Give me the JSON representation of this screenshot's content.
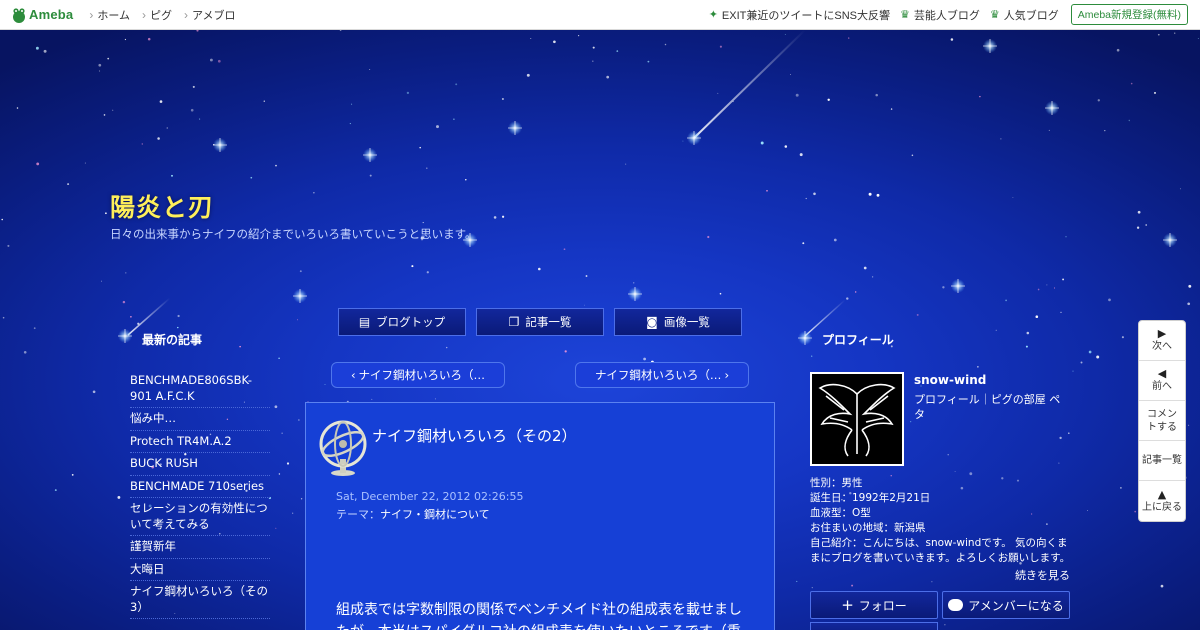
{
  "topbar": {
    "logo_text": "Ameba",
    "nav": [
      "ホーム",
      "ピグ",
      "アメブロ"
    ],
    "right_links": [
      {
        "icon": "sparkle-icon",
        "label": "EXIT兼近のツイートにSNS大反響"
      },
      {
        "icon": "crown-icon",
        "label": "芸能人ブログ"
      },
      {
        "icon": "crown-icon",
        "label": "人気ブログ"
      }
    ],
    "signup_label": "Ameba新規登録(無料)"
  },
  "blog": {
    "title": "陽炎と刃",
    "description": "日々の出来事からナイフの紹介までいろいろ書いていこうと思います。"
  },
  "left_sidebar": {
    "heading": "最新の記事",
    "recent": [
      "BENCHMADE806SBK-901 A.F.C.K",
      "悩み中…",
      "Protech TR4M.A.2",
      "BUCK RUSH",
      "BENCHMADE 710series",
      "セレーションの有効性について考えてみる",
      "謹賀新年",
      "大晦日",
      "ナイフ鋼材いろいろ（その3）"
    ]
  },
  "center": {
    "nav_buttons": [
      {
        "icon": "list-icon",
        "label": "ブログトップ"
      },
      {
        "icon": "document-icon",
        "label": "記事一覧"
      },
      {
        "icon": "camera-icon",
        "label": "画像一覧"
      }
    ],
    "prev_label": "ナイフ鋼材いろいろ（…",
    "next_label": "ナイフ鋼材いろいろ（…",
    "article": {
      "title": "ナイフ鋼材いろいろ（その2）",
      "date": "Sat, December 22, 2012 02:26:55",
      "theme_key": "テーマ：",
      "theme_value": "ナイフ・鋼材について",
      "body": "組成表では字数制限の関係でベンチメイド社の組成表を載せましたが、本当はスパイダルコ社の組成表を使いたいところです（重"
    }
  },
  "right_sidebar": {
    "heading": "プロフィール",
    "name": "snow-wind",
    "links": "プロフィール｜ピグの部屋 ペタ",
    "info": [
      "性別：男性",
      "誕生日：1992年2月21日",
      "血液型：O型",
      "お住まいの地域：新潟県",
      "自己紹介：こんにちは、snow-windです。 気の向くままにブログを書いていきます。よろしくお願いします。"
    ],
    "more_label": "続きを見る",
    "follow_label": "フォロー",
    "amember_label": "アメンバーになる"
  },
  "side_nav": {
    "items": [
      {
        "arrow": "▶",
        "label": "次へ"
      },
      {
        "arrow": "◀",
        "label": "前へ"
      },
      {
        "arrow": "",
        "label": "コメントする"
      },
      {
        "arrow": "",
        "label": "記事一覧"
      },
      {
        "arrow": "▲",
        "label": "上に戻る"
      }
    ]
  },
  "colors": {
    "title_yellow": "#ffef5a",
    "ameba_green": "#2d8c3c",
    "article_blue": "#1640d6"
  }
}
